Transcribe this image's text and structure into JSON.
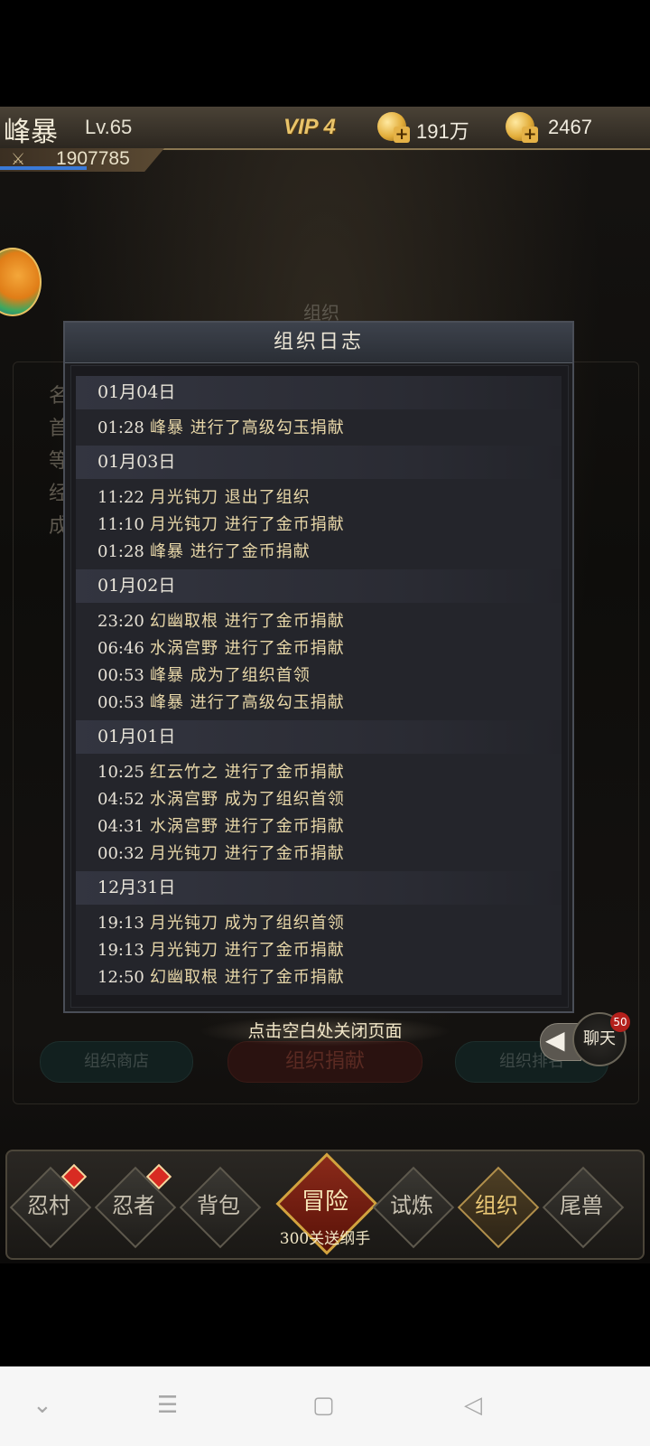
{
  "player": {
    "name": "峰暴",
    "level": "Lv.65",
    "vip": "VIP 4",
    "power": "1907785"
  },
  "currencies": [
    {
      "icon": "coin-plus-icon",
      "value": "191万"
    },
    {
      "icon": "key-plus-icon",
      "value": "2467"
    }
  ],
  "background_panel": {
    "title": "组织",
    "labels": [
      "名",
      "首",
      "等",
      "经",
      "成"
    ],
    "buttons": [
      "组织商店",
      "组织捐献",
      "组织排名"
    ]
  },
  "modal": {
    "title": "组织日志",
    "days": [
      {
        "date": "01月04日",
        "entries": [
          {
            "time": "01:28",
            "text": "峰暴 进行了高级勾玉捐献"
          }
        ]
      },
      {
        "date": "01月03日",
        "entries": [
          {
            "time": "11:22",
            "text": "月光钝刀 退出了组织"
          },
          {
            "time": "11:10",
            "text": "月光钝刀 进行了金币捐献"
          },
          {
            "time": "01:28",
            "text": "峰暴 进行了金币捐献"
          }
        ]
      },
      {
        "date": "01月02日",
        "entries": [
          {
            "time": "23:20",
            "text": "幻幽取根 进行了金币捐献"
          },
          {
            "time": "06:46",
            "text": "水涡宫野 进行了金币捐献"
          },
          {
            "time": "00:53",
            "text": "峰暴 成为了组织首领"
          },
          {
            "time": "00:53",
            "text": "峰暴 进行了高级勾玉捐献"
          }
        ]
      },
      {
        "date": "01月01日",
        "entries": [
          {
            "time": "10:25",
            "text": "红云竹之 进行了金币捐献"
          },
          {
            "time": "04:52",
            "text": "水涡宫野 成为了组织首领"
          },
          {
            "time": "04:31",
            "text": "水涡宫野 进行了金币捐献"
          },
          {
            "time": "00:32",
            "text": "月光钝刀 进行了金币捐献"
          }
        ]
      },
      {
        "date": "12月31日",
        "entries": [
          {
            "time": "19:13",
            "text": "月光钝刀 成为了组织首领"
          },
          {
            "time": "19:13",
            "text": "月光钝刀 进行了金币捐献"
          },
          {
            "time": "12:50",
            "text": "幻幽取根 进行了金币捐献"
          }
        ]
      }
    ]
  },
  "close_hint": "点击空白处关闭页面",
  "chat": {
    "label": "聊天",
    "badge": "50"
  },
  "nav": {
    "items": [
      {
        "label": "忍村",
        "badge": true
      },
      {
        "label": "忍者",
        "badge": true
      },
      {
        "label": "背包",
        "badge": false
      },
      {
        "label": "冒险",
        "badge": false
      },
      {
        "label": "试炼",
        "badge": false
      },
      {
        "label": "组织",
        "badge": false,
        "active": true
      },
      {
        "label": "尾兽",
        "badge": false
      }
    ],
    "adventure_subtitle": "300关送纲手"
  },
  "colors": {
    "entry_text": "#e8d7a8",
    "accent_gold": "#e9c46a",
    "badge_red": "#d82b22"
  }
}
